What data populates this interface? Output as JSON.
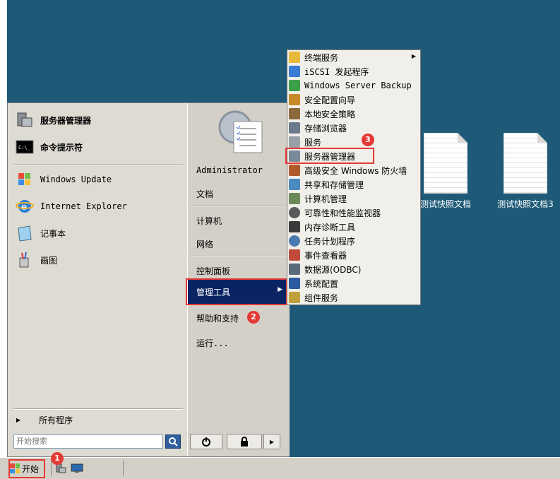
{
  "desktop": {
    "icons": [
      {
        "label": "测试快照文档"
      },
      {
        "label": "测试快照文档3"
      }
    ]
  },
  "start_menu": {
    "left_items": [
      {
        "label": "服务器管理器",
        "icon": "server-manager-icon"
      },
      {
        "label": "命令提示符",
        "icon": "cmd-icon"
      },
      {
        "label": "Windows Update",
        "icon": "windows-update-icon"
      },
      {
        "label": "Internet Explorer",
        "icon": "ie-icon"
      },
      {
        "label": "记事本",
        "icon": "notepad-icon"
      },
      {
        "label": "画图",
        "icon": "paint-icon"
      }
    ],
    "all_programs": "所有程序",
    "search_placeholder": "开始搜索",
    "right_items": {
      "user": "Administrator",
      "documents": "文档",
      "computer": "计算机",
      "network": "网络",
      "control_panel": "控制面板",
      "admin_tools": "管理工具",
      "help": "帮助和支持",
      "run": "运行..."
    }
  },
  "submenu": {
    "items": [
      {
        "label": "终端服务",
        "color": "#e8b83a"
      },
      {
        "label": "iSCSI 发起程序",
        "color": "#3a7bd5"
      },
      {
        "label": "Windows Server Backup",
        "color": "#3aa04a"
      },
      {
        "label": "安全配置向导",
        "color": "#c98a2a"
      },
      {
        "label": "本地安全策略",
        "color": "#8a6a3a"
      },
      {
        "label": "存储浏览器",
        "color": "#6a7a8a"
      },
      {
        "label": "服务",
        "color": "#9aa0a8"
      },
      {
        "label": "服务器管理器",
        "color": "#7a8a9a"
      },
      {
        "label": "高级安全 Windows 防火墙",
        "color": "#b05a2a"
      },
      {
        "label": "共享和存储管理",
        "color": "#4a8ac0"
      },
      {
        "label": "计算机管理",
        "color": "#6a8a5a"
      },
      {
        "label": "可靠性和性能监视器",
        "color": "#5a5a5a"
      },
      {
        "label": "内存诊断工具",
        "color": "#3a3a3a"
      },
      {
        "label": "任务计划程序",
        "color": "#4a7ab0"
      },
      {
        "label": "事件查看器",
        "color": "#c04a3a"
      },
      {
        "label": "数据源(ODBC)",
        "color": "#5a6a7a"
      },
      {
        "label": "系统配置",
        "color": "#2a5aa0"
      },
      {
        "label": "组件服务",
        "color": "#c0a03a"
      }
    ]
  },
  "taskbar": {
    "start_label": "开始"
  },
  "annotations": {
    "badge1": "1",
    "badge2": "2",
    "badge3": "3"
  },
  "colors": {
    "desktop_bg": "#1e5a78",
    "highlight": "#0a2463",
    "annotation_red": "#e53935"
  }
}
